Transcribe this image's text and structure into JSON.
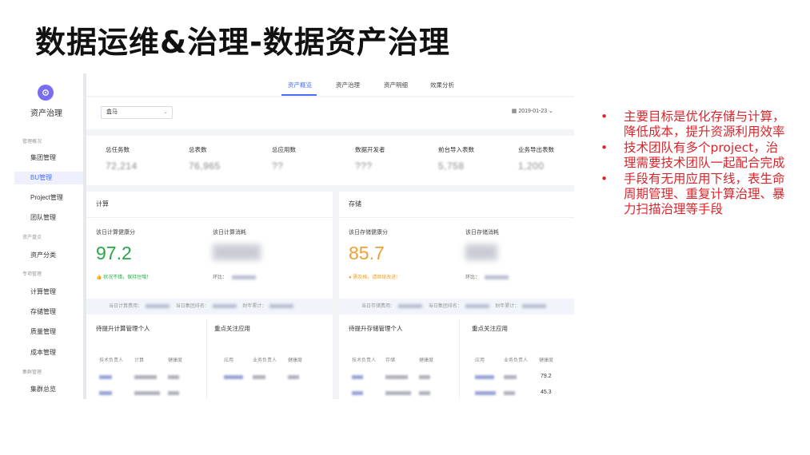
{
  "slide": {
    "title": "数据运维&治理-数据资产治理"
  },
  "sidebar": {
    "title": "资产治理",
    "groups": [
      {
        "label": "管理概况",
        "items": [
          "集团管理",
          "BU管理",
          "Project管理",
          "团队管理"
        ]
      },
      {
        "label": "资产盘点",
        "items": [
          "资产分类"
        ]
      },
      {
        "label": "专项管理",
        "items": [
          "计算管理",
          "存储管理",
          "质量管理",
          "成本管理"
        ]
      },
      {
        "label": "集群管理",
        "items": [
          "集群总览"
        ]
      }
    ],
    "active_item": "BU管理"
  },
  "tabs": [
    "资产概览",
    "资产治理",
    "资产明细",
    "效果分析"
  ],
  "active_tab": "资产概览",
  "filter": {
    "select_value": "盒马",
    "date": "2019-01-23"
  },
  "stats": [
    {
      "label": "总任务数",
      "value": "72,214"
    },
    {
      "label": "总表数",
      "value": "76,965"
    },
    {
      "label": "总应用数",
      "value": "??"
    },
    {
      "label": "数据开发者",
      "value": "???"
    },
    {
      "label": "前台导入表数",
      "value": "5,758"
    },
    {
      "label": "业务导出表数",
      "value": "1,200"
    }
  ],
  "compute": {
    "title": "计算",
    "health_label": "该日计算健康分",
    "health_value": "97.2",
    "consume_label": "该日计算消耗",
    "status": "状况不错，保持住哦！",
    "huanbi_label": "环比：",
    "footer": {
      "cost_label": "当日计算费用：",
      "rank_label": "当日集团排名：",
      "year_label": "财年累计："
    },
    "list1_title": "待提升计算管理个人",
    "list2_title": "重点关注应用",
    "list1_headers": [
      "技术负责人",
      "计算",
      "健康度"
    ],
    "list2_headers": [
      "应用",
      "业务负责人",
      "健康度"
    ]
  },
  "storage": {
    "title": "存储",
    "health_label": "该日存储健康分",
    "health_value": "85.7",
    "consume_label": "该日存储消耗",
    "status": "需及格，请继续改进!",
    "huanbi_label": "环比：",
    "footer": {
      "cost_label": "当日存储费用：",
      "rank_label": "当日集团排名：",
      "year_label": "财年累计："
    },
    "list1_title": "待提升存储管理个人",
    "list2_title": "重点关注应用",
    "list1_headers": [
      "技术负责人",
      "存储",
      "健康度"
    ],
    "list2_headers": [
      "应用",
      "业务负责人",
      "健康度"
    ],
    "app_scores": [
      "79.2",
      "45.3"
    ]
  },
  "bullets": [
    "主要目标是优化存储与计算，降低成本，提升资源利用效率",
    "技术团队有多个project，治理需要技术团队一起配合完成",
    "手段有无用应用下线，表生命周期管理、重复计算治理、暴力扫描治理等手段"
  ],
  "colors": {
    "accent": "#4c6ef5",
    "good": "#28a745",
    "warn": "#f0a030",
    "bullet": "#d9262c"
  }
}
